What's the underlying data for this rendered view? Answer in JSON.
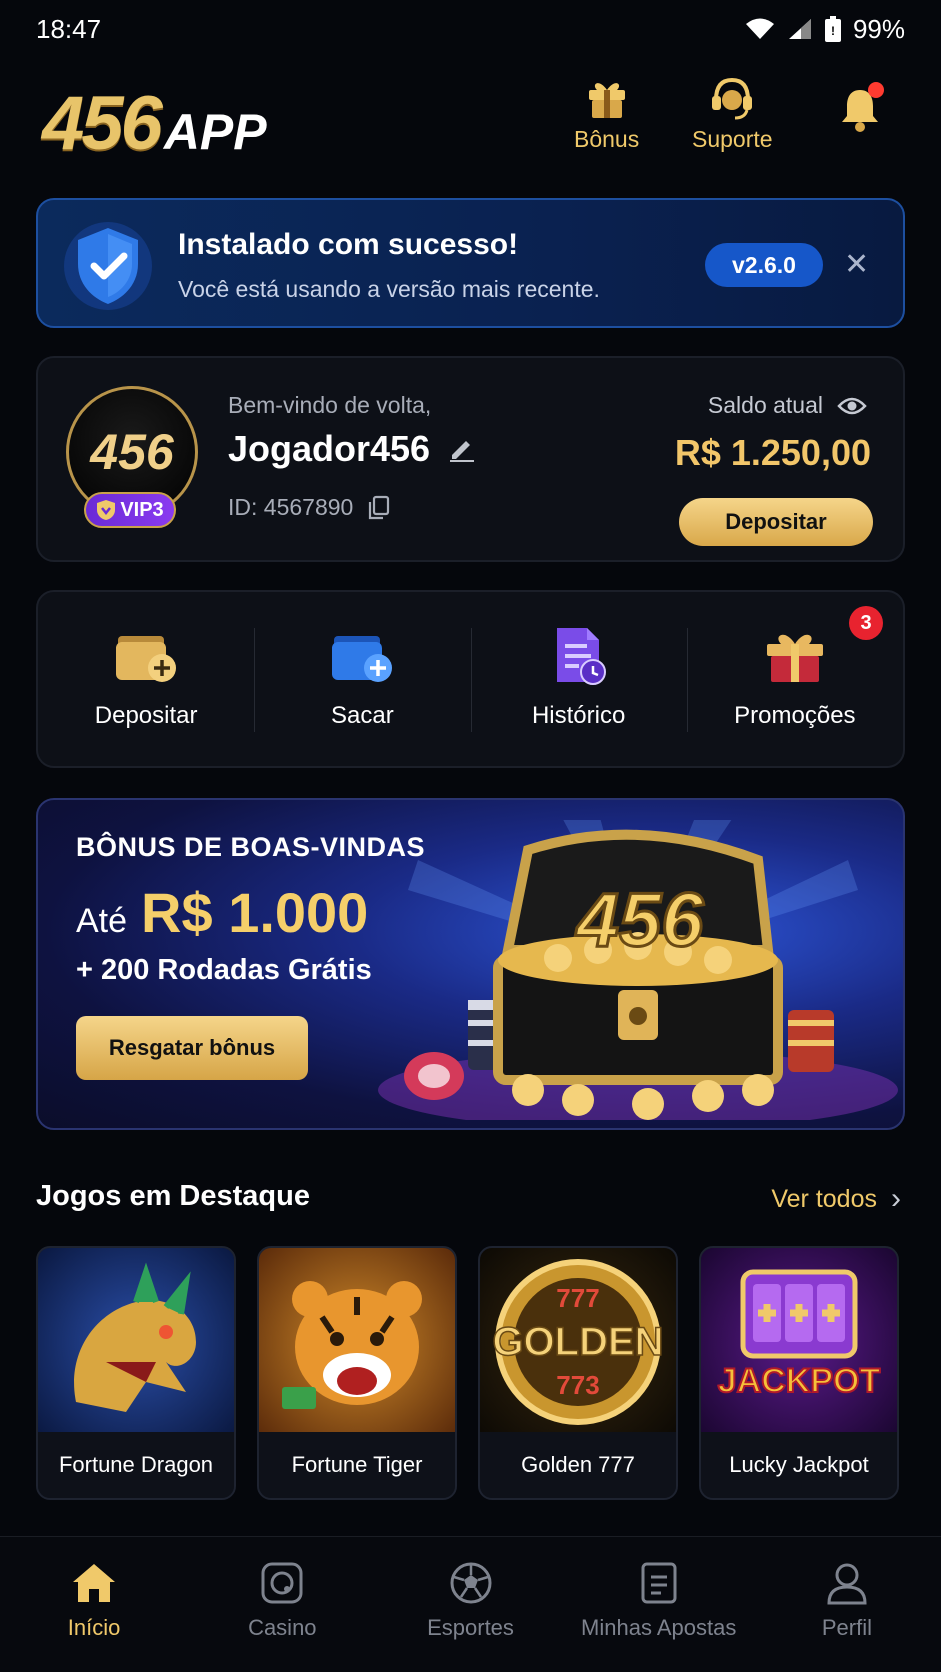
{
  "status_bar": {
    "time": "18:47",
    "battery": "99%"
  },
  "header": {
    "logo_number": "456",
    "logo_suffix": "APP",
    "bonus_label": "Bônus",
    "support_label": "Suporte"
  },
  "install_banner": {
    "title": "Instalado com sucesso!",
    "subtitle": "Você está usando a versão mais recente.",
    "version": "v2.6.0",
    "close": "✕"
  },
  "profile": {
    "avatar_text": "456",
    "vip": "VIP3",
    "welcome": "Bem-vindo de volta,",
    "username": "Jogador456",
    "id_text": "ID: 4567890",
    "balance_label": "Saldo atual",
    "balance": "R$ 1.250,00",
    "deposit_button": "Depositar"
  },
  "actions": [
    {
      "label": "Depositar",
      "icon": "wallet-add-icon"
    },
    {
      "label": "Sacar",
      "icon": "wallet-withdraw-icon"
    },
    {
      "label": "Histórico",
      "icon": "history-document-icon"
    },
    {
      "label": "Promoções",
      "icon": "gift-icon",
      "badge": "3"
    }
  ],
  "promo": {
    "title": "BÔNUS DE BOAS-VINDAS",
    "prefix": "Até",
    "amount": "R$ 1.000",
    "spins": "+ 200 Rodadas Grátis",
    "button": "Resgatar bônus",
    "chest_text": "456"
  },
  "featured": {
    "title": "Jogos em Destaque",
    "see_all": "Ver todos",
    "games": [
      {
        "name": "Fortune Dragon",
        "art": "dragon-art"
      },
      {
        "name": "Fortune Tiger",
        "art": "tiger-art"
      },
      {
        "name": "Golden 777",
        "art": "golden-art",
        "art_text": "GOLDEN"
      },
      {
        "name": "Lucky Jackpot",
        "art": "jackpot-art",
        "art_text": "JACKPOT"
      }
    ]
  },
  "bottom_nav": [
    {
      "label": "Início",
      "icon": "home-icon",
      "active": true
    },
    {
      "label": "Casino",
      "icon": "casino-chip-icon"
    },
    {
      "label": "Esportes",
      "icon": "soccer-ball-icon"
    },
    {
      "label": "Minhas Apostas",
      "icon": "ticket-icon"
    },
    {
      "label": "Perfil",
      "icon": "user-icon"
    }
  ],
  "colors": {
    "gold": "#f0c96a",
    "accent_blue": "#1657c9",
    "background": "#05070c",
    "badge_red": "#e8232f"
  }
}
